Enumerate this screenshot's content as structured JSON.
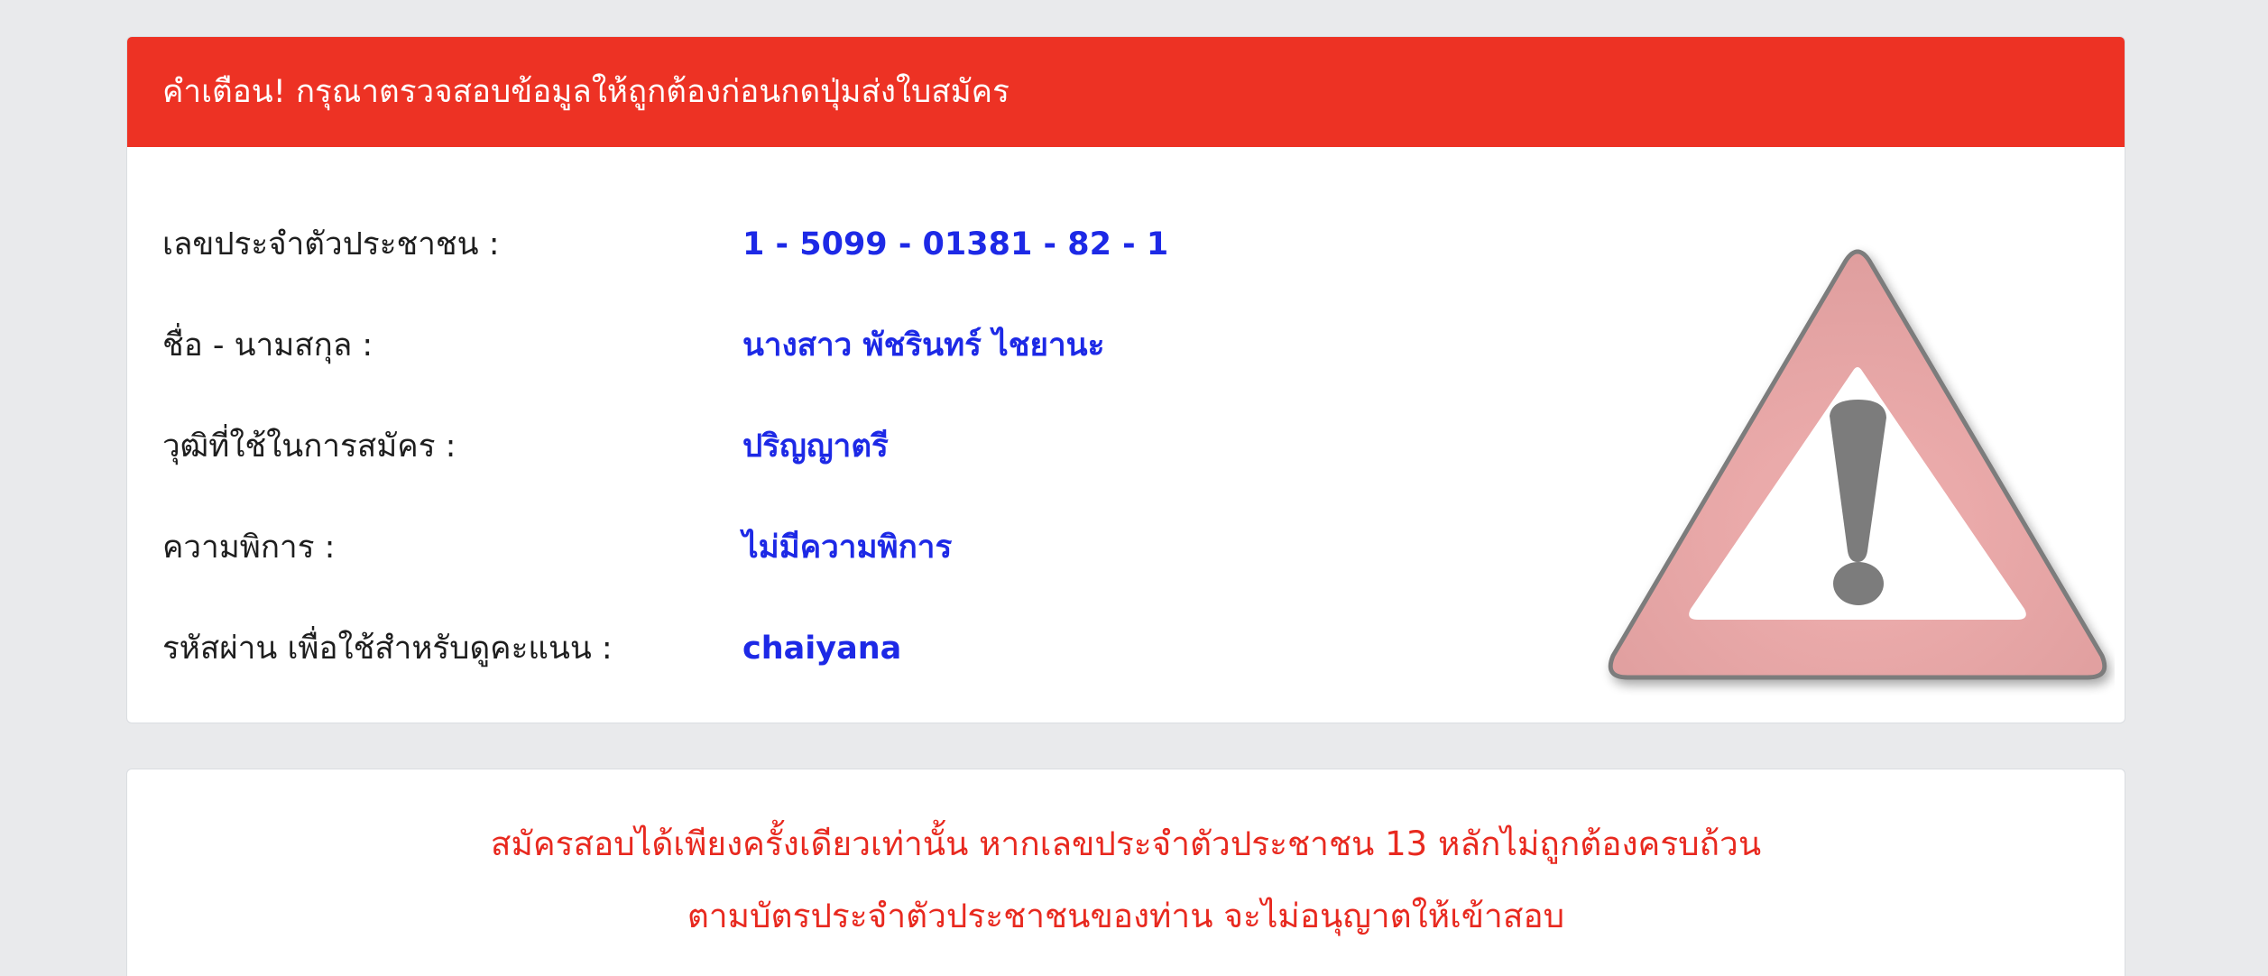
{
  "header": {
    "title": "คำเตือน! กรุณาตรวจสอบข้อมูลให้ถูกต้องก่อนกดปุ่มส่งใบสมัคร"
  },
  "fields": [
    {
      "label": "เลขประจำตัวประชาชน :",
      "value": "1 - 5099 - 01381 - 82 - 1"
    },
    {
      "label": "ชื่อ - นามสกุล :",
      "value": "นางสาว พัชรินทร์ ไชยานะ"
    },
    {
      "label": "วุฒิที่ใช้ในการสมัคร :",
      "value": "ปริญญาตรี"
    },
    {
      "label": "ความพิการ :",
      "value": "ไม่มีความพิการ"
    },
    {
      "label": "รหัสผ่าน เพื่อใช้สำหรับดูคะแนน :",
      "value": "chaiyana"
    }
  ],
  "warning_icon": "warning-triangle-icon",
  "notice": {
    "line1": "สมัครสอบได้เพียงครั้งเดียวเท่านั้น หากเลขประจำตัวประชาชน 13 หลักไม่ถูกต้องครบถ้วน",
    "line2": "ตามบัตรประจำตัวประชาชนของท่าน จะไม่อนุญาตให้เข้าสอบ"
  },
  "colors": {
    "header_bg": "#ed3224",
    "value_text": "#1d29e6",
    "notice_text": "#e8291f",
    "page_bg": "#e9eaec"
  }
}
